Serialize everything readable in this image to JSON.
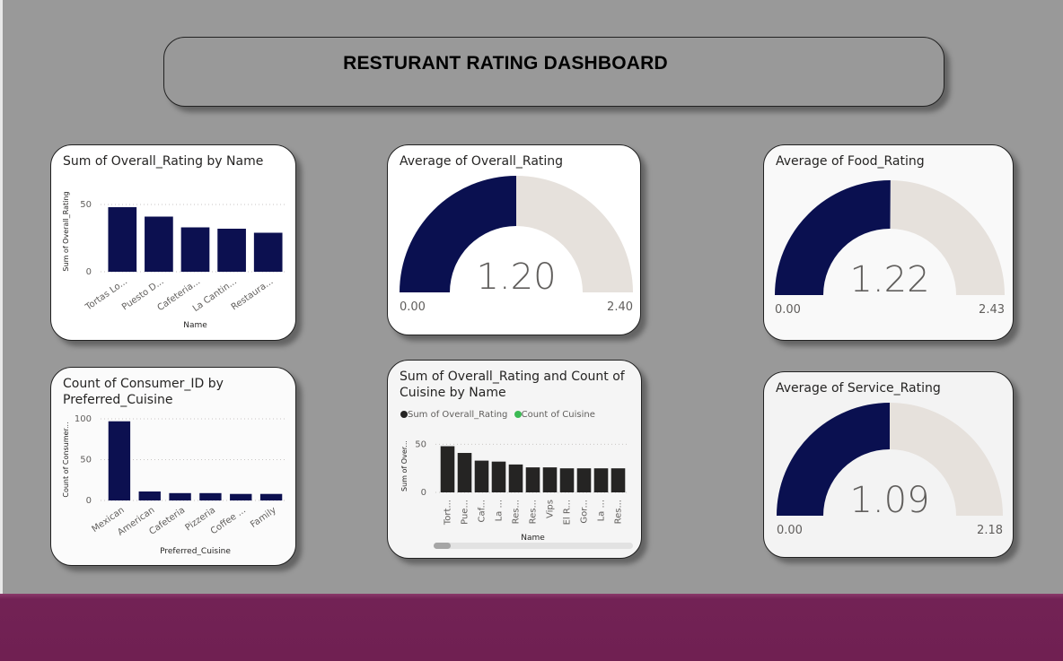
{
  "dashboard": {
    "title": "RESTURANT RATING DASHBOARD"
  },
  "colors": {
    "bar_navy": "#0c1050",
    "bar_dark": "#252423",
    "gauge_fill": "#0a1050",
    "gauge_track": "#e6e1dc",
    "legend_green": "#3cba54",
    "background": "#999999",
    "footer": "#722255"
  },
  "chart_data": [
    {
      "id": "rating_by_name",
      "type": "bar",
      "title": "Sum of Overall_Rating by Name",
      "xlabel": "Name",
      "ylabel": "Sum of Overall_Rating",
      "categories": [
        "Tortas Lo...",
        "Puesto D...",
        "Cafeteria...",
        "La Cantin...",
        "Restaura..."
      ],
      "values": [
        48,
        41,
        33,
        32,
        29
      ],
      "ylim": [
        0,
        60
      ],
      "yticks": [
        0,
        50
      ],
      "grid": true
    },
    {
      "id": "consumer_by_cuisine",
      "type": "bar",
      "title": "Count of Consumer_ID by Preferred_Cuisine",
      "xlabel": "Preferred_Cuisine",
      "ylabel": "Count of Consumer...",
      "categories": [
        "Mexican",
        "American",
        "Cafeteria",
        "Pizzeria",
        "Coffee ...",
        "Family"
      ],
      "values": [
        97,
        11,
        9,
        9,
        8,
        8
      ],
      "ylim": [
        0,
        100
      ],
      "yticks": [
        0,
        50,
        100
      ],
      "grid": true
    },
    {
      "id": "rating_and_cuisine_by_name",
      "type": "bar",
      "title": "Sum of Overall_Rating and Count of Cuisine by Name",
      "xlabel": "Name",
      "ylabel": "Sum of Over...",
      "legend": "top-left",
      "categories": [
        "Tort...",
        "Pue...",
        "Caf...",
        "La ...",
        "Res...",
        "Res...",
        "Vips",
        "El R...",
        "Gor...",
        "La ...",
        "Res..."
      ],
      "series": [
        {
          "name": "Sum of Overall_Rating",
          "values": [
            48,
            41,
            33,
            32,
            29,
            26,
            26,
            25,
            25,
            25,
            25
          ]
        },
        {
          "name": "Count of Cuisine",
          "values": []
        }
      ],
      "ylim": [
        0,
        55
      ],
      "yticks": [
        0,
        50
      ],
      "grid": true
    },
    {
      "id": "avg_overall",
      "type": "gauge",
      "title": "Average of Overall_Rating",
      "value": 1.2,
      "value_label": "1.20",
      "min": 0,
      "max": 2.4,
      "min_label": "0.00",
      "max_label": "2.40"
    },
    {
      "id": "avg_food",
      "type": "gauge",
      "title": "Average of Food_Rating",
      "value": 1.22,
      "value_label": "1.22",
      "min": 0,
      "max": 2.43,
      "min_label": "0.00",
      "max_label": "2.43"
    },
    {
      "id": "avg_service",
      "type": "gauge",
      "title": "Average of Service_Rating",
      "value": 1.09,
      "value_label": "1.09",
      "min": 0,
      "max": 2.18,
      "min_label": "0.00",
      "max_label": "2.18"
    }
  ]
}
